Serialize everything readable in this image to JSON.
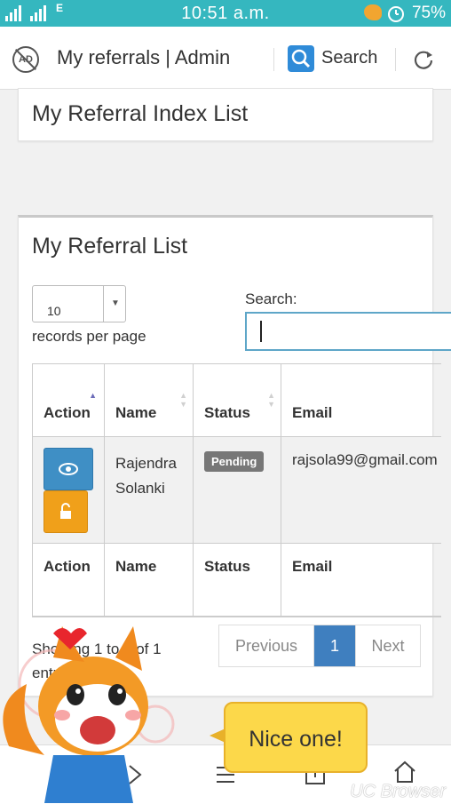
{
  "status_bar": {
    "network_label": "E",
    "time": "10:51 a.m.",
    "battery": "75%"
  },
  "browser_bar": {
    "title": "My referrals | Admin",
    "search_label": "Search",
    "watermark": "UC Browser"
  },
  "index_panel": {
    "title": "My Referral Index List"
  },
  "list_panel": {
    "title": "My Referral List",
    "page_size": "10",
    "records_per_page_label": "records per page",
    "search_label": "Search:",
    "search_value": "",
    "columns": [
      "Action",
      "Name",
      "Status",
      "Email"
    ],
    "rows": [
      {
        "name": "Rajendra Solanki",
        "status": "Pending",
        "email": "rajsola99@gmail.com"
      }
    ],
    "info_text": "Showing 1 to 1 of 1 entries",
    "pagination": {
      "previous": "Previous",
      "current": "1",
      "next": "Next"
    }
  },
  "overlay": {
    "bubble_text": "Nice one!"
  },
  "colors": {
    "status_bar": "#35b7bf",
    "primary": "#3f8fc5",
    "warning": "#f0a01a",
    "pending_badge": "#777777",
    "bubble": "#fcd84a"
  }
}
